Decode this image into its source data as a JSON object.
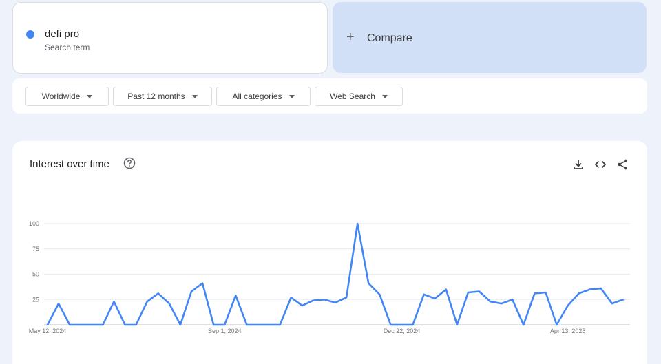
{
  "search_term": {
    "name": "defi pro",
    "subtitle": "Search term",
    "color": "#4285f4"
  },
  "compare": {
    "label": "Compare",
    "icon": "plus-icon"
  },
  "filters": [
    {
      "label": "Worldwide",
      "icon": "caret-down-icon"
    },
    {
      "label": "Past 12 months",
      "icon": "caret-down-icon"
    },
    {
      "label": "All categories",
      "icon": "caret-down-icon"
    },
    {
      "label": "Web Search",
      "icon": "caret-down-icon"
    }
  ],
  "chart_card": {
    "title": "Interest over time",
    "help_icon": "help-circle-icon",
    "actions": [
      "download-icon",
      "embed-code-icon",
      "share-icon"
    ]
  },
  "chart_data": {
    "type": "line",
    "title": "Interest over time",
    "ylim": [
      0,
      100
    ],
    "yticks": [
      "100",
      "75",
      "50",
      "25"
    ],
    "ytick_values": [
      100,
      75,
      50,
      25
    ],
    "xtick_labels": [
      "May 12, 2024",
      "Sep 1, 2024",
      "Dec 22, 2024",
      "Apr 13, 2025"
    ],
    "xtick_indices": [
      0,
      16,
      32,
      47
    ],
    "grid": true,
    "series": [
      {
        "color": "#4285f4",
        "values": [
          0,
          21,
          0,
          0,
          0,
          0,
          23,
          0,
          0,
          23,
          31,
          21,
          0,
          33,
          41,
          0,
          0,
          29,
          0,
          0,
          0,
          0,
          27,
          19,
          24,
          25,
          22,
          27,
          100,
          41,
          30,
          0,
          0,
          0,
          30,
          26,
          35,
          0,
          32,
          33,
          23,
          21,
          25,
          0,
          31,
          32,
          0,
          19,
          31,
          35,
          36,
          21,
          25
        ]
      }
    ]
  }
}
